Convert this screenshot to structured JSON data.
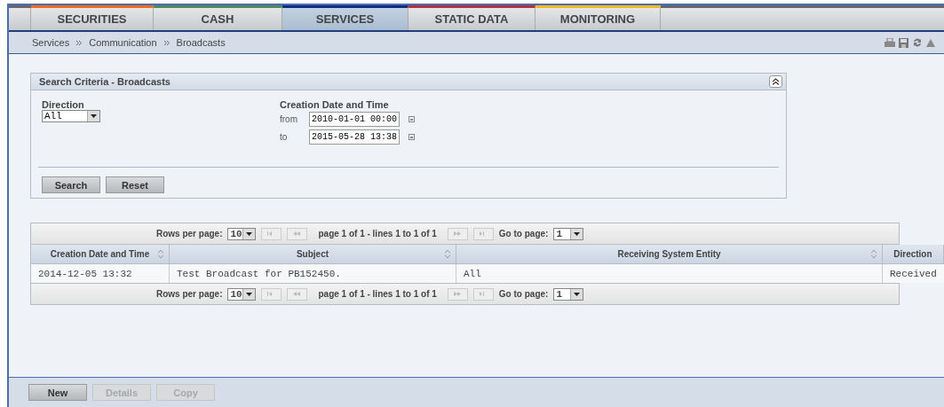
{
  "tabs": [
    {
      "label": "SECURITIES",
      "color": "#f26a1b",
      "selected": false
    },
    {
      "label": "CASH",
      "color": "#4e8a5a",
      "selected": false
    },
    {
      "label": "SERVICES",
      "color": "#0b2d7a",
      "selected": true
    },
    {
      "label": "STATIC DATA",
      "color": "#b3323a",
      "selected": false
    },
    {
      "label": "MONITORING",
      "color": "#f3b81f",
      "selected": false
    }
  ],
  "breadcrumb": [
    "Services",
    "Communication",
    "Broadcasts"
  ],
  "search_panel": {
    "title": "Search Criteria - Broadcasts",
    "direction": {
      "label": "Direction",
      "value": "All"
    },
    "creation": {
      "label": "Creation Date and Time",
      "from_label": "from",
      "from": "2010-01-01 00:00",
      "to_label": "to",
      "to": "2015-05-28 13:38"
    },
    "buttons": [
      "Search",
      "Reset"
    ]
  },
  "pagers": [
    {
      "rows_label": "Rows per page:",
      "rows": "10",
      "info": "page 1 of 1 - lines 1 to 1 of 1",
      "goto_label": "Go to page:",
      "page": "1"
    },
    {
      "rows_label": "Rows per page:",
      "rows": "10",
      "info": "page 1 of 1 - lines 1 to 1 of 1",
      "goto_label": "Go to page:",
      "page": "1"
    }
  ],
  "table": {
    "columns": [
      {
        "label": "Creation Date and Time",
        "sortable": true
      },
      {
        "label": "Subject",
        "sortable": true
      },
      {
        "label": "Receiving System Entity",
        "sortable": true
      },
      {
        "label": "Direction",
        "sortable": false
      }
    ],
    "rows": [
      [
        "2014-12-05 13:32",
        "Test Broadcast for PB152450.",
        "All",
        "Received"
      ]
    ]
  },
  "actions": [
    {
      "label": "New",
      "disabled": false
    },
    {
      "label": "Details",
      "disabled": true
    },
    {
      "label": "Copy",
      "disabled": true
    }
  ]
}
